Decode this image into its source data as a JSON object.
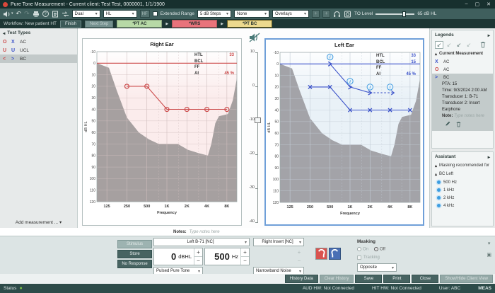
{
  "window": {
    "title": "Pure Tone Measurement - Current client: Test Test, 0000001, 1/1/1900"
  },
  "icons": {
    "caret_down": "▾",
    "arrow_right_small": "▸",
    "collapse_up": "▴",
    "sidebar_collapse": "◂",
    "undo": "↶",
    "redo": "↷",
    "legend_icon": "↙",
    "minimize": "–",
    "maximize": "▢",
    "close": "✕",
    "help": "?",
    "plus": "+",
    "minus": "−",
    "status_dot": "●",
    "workflow_arrow": "▶",
    "info": "i",
    "popout": "▣"
  },
  "colors": {
    "right_ear_accent": "#cc4b4b",
    "left_ear_accent": "#3b52c9",
    "masking_badge": "#3f9be0",
    "workflow_green": "#b7d9a6",
    "workflow_red": "#e8737b",
    "workflow_yellow": "#ecd98e",
    "status_ok": "#7ac143"
  },
  "toolbar": {
    "dual_select": "Dual",
    "hl_select": "HL",
    "hf_button": "HF",
    "extended_range_label": "Extended Range",
    "step_select": "5 dB Steps",
    "stimulus_select": "None",
    "overlays_select": "Overlays",
    "to_level_label": "TO Level",
    "to_level_value": "65 dB HL"
  },
  "workflow": {
    "label": "Workflow: New patient HT",
    "finish_button": "Finish",
    "next_step_button": "Next Step",
    "steps": [
      {
        "label": "*PT AC",
        "state": "done"
      },
      {
        "label": "*WRS",
        "state": "done"
      },
      {
        "label": "*PT BC",
        "state": "current"
      }
    ]
  },
  "test_types": {
    "header": "Test Types",
    "items": [
      {
        "left_symbol": "O",
        "right_symbol": "X",
        "label": "AC",
        "selected": false
      },
      {
        "left_symbol": "U",
        "right_symbol": "U",
        "label": "UCL",
        "selected": false
      },
      {
        "left_symbol": "<",
        "right_symbol": ">",
        "label": "BC",
        "selected": true
      }
    ],
    "add_measurement": "Add measurement ..."
  },
  "level_slider": {
    "tick_labels": [
      "10",
      "0",
      "-10",
      "-20",
      "-30",
      "-40"
    ],
    "handle_at": "-10"
  },
  "chart_data": [
    {
      "id": "r",
      "name": "right-ear-audiogram",
      "type": "line",
      "title": "Right Ear",
      "xlabel": "Frequency",
      "ylabel": "dB HL",
      "x_ticks": [
        "125",
        "250",
        "500",
        "1K",
        "2K",
        "4K",
        "8K"
      ],
      "tick_freqs": [
        125,
        250,
        500,
        1000,
        2000,
        4000,
        8000
      ],
      "minor_gridlines": [
        750,
        1500,
        3000,
        6000
      ],
      "ylim": [
        -10,
        120
      ],
      "accent": "#cc4b4b",
      "bg_tint": "#fbecec",
      "shade_color": "#a6a0a0",
      "grid_color": "#cfbdbd",
      "zero_line_db": 0,
      "selected": false,
      "series": [
        {
          "name": "AC Right",
          "marker": "circle",
          "style": "solid",
          "color": "#cc4b4b",
          "x": [
            250,
            500,
            1000,
            2000,
            4000,
            8000
          ],
          "y": [
            20,
            20,
            40,
            40,
            40,
            40
          ]
        }
      ],
      "masking_badges": [],
      "legend": [
        {
          "label": "HTL",
          "value": "33"
        },
        {
          "label": "BCL",
          "value": ""
        },
        {
          "label": "FF",
          "value": ""
        },
        {
          "label": "AI",
          "value": "45 %"
        }
      ],
      "shaded_region": [
        [
          0,
          0
        ],
        [
          0.6,
          4
        ],
        [
          1.0,
          24
        ],
        [
          1.5,
          47
        ],
        [
          2.1,
          60
        ],
        [
          2.6,
          66
        ],
        [
          3.1,
          70
        ],
        [
          4.05,
          70
        ],
        [
          4.55,
          75
        ],
        [
          5.1,
          78
        ],
        [
          5.55,
          80
        ],
        [
          5.72,
          70
        ],
        [
          5.92,
          52
        ],
        [
          6.1,
          46
        ],
        [
          6.55,
          44
        ],
        [
          6.8,
          32
        ],
        [
          7,
          13
        ]
      ]
    },
    {
      "id": "l",
      "name": "left-ear-audiogram",
      "type": "line",
      "title": "Left Ear",
      "xlabel": "Frequency",
      "ylabel": "dB HL",
      "x_ticks": [
        "125",
        "250",
        "500",
        "1K",
        "2K",
        "4K",
        "8K"
      ],
      "tick_freqs": [
        125,
        250,
        500,
        1000,
        2000,
        4000,
        8000
      ],
      "minor_gridlines": [
        750,
        1500,
        3000,
        6000
      ],
      "ylim": [
        -10,
        120
      ],
      "accent": "#3b52c9",
      "bg_tint": "#e9f1f7",
      "shade_color": "#a3a3a8",
      "grid_color": "#c2ccd6",
      "zero_line_db": 0,
      "selected": true,
      "series": [
        {
          "name": "AC Left",
          "marker": "x",
          "style": "solid",
          "color": "#3b52c9",
          "x": [
            250,
            500,
            1000,
            2000,
            4000,
            8000
          ],
          "y": [
            20,
            20,
            40,
            40,
            40,
            40
          ]
        },
        {
          "name": "BC Left",
          "marker": "gt",
          "style": "solid",
          "color": "#3b52c9",
          "x": [
            500,
            1000,
            2000
          ],
          "y": [
            0,
            20,
            25
          ]
        },
        {
          "name": "BC Left extension",
          "marker": "none",
          "style": "dashed",
          "arrow": true,
          "color": "#3b52c9",
          "x": [
            2000,
            4600
          ],
          "y": [
            25,
            25
          ]
        }
      ],
      "masking_badges": [
        [
          500,
          -6
        ],
        [
          1000,
          15
        ],
        [
          2000,
          20
        ],
        [
          4000,
          20
        ]
      ],
      "legend": [
        {
          "label": "HTL",
          "value": "33"
        },
        {
          "label": "BCL",
          "value": "15"
        },
        {
          "label": "FF",
          "value": ""
        },
        {
          "label": "AI",
          "value": "45 %"
        }
      ],
      "shaded_region": [
        [
          0,
          0
        ],
        [
          0.6,
          4
        ],
        [
          1.0,
          24
        ],
        [
          1.5,
          47
        ],
        [
          2.1,
          60
        ],
        [
          2.6,
          66
        ],
        [
          3.1,
          70
        ],
        [
          4.05,
          70
        ],
        [
          4.55,
          75
        ],
        [
          5.1,
          78
        ],
        [
          5.55,
          80
        ],
        [
          5.72,
          70
        ],
        [
          5.92,
          52
        ],
        [
          6.1,
          46
        ],
        [
          6.55,
          44
        ],
        [
          6.8,
          32
        ],
        [
          7,
          13
        ]
      ]
    }
  ],
  "legends_panel": {
    "header": "Legends",
    "current_measurement": {
      "header": "Current Measurement",
      "items": [
        {
          "symbol": "X",
          "label": "AC",
          "selected": false
        },
        {
          "symbol": "O",
          "label": "AC",
          "selected": false
        },
        {
          "symbol": ">",
          "label": "BC",
          "selected": true
        }
      ],
      "details": [
        "PTA: 15",
        "Time: 9/3/2024 2:00 AM",
        "Transducer 1: B-71",
        "Transducer 2: Insert Earphone"
      ],
      "note_label": "Note:",
      "note_placeholder": "Type notes here"
    }
  },
  "assistant": {
    "header": "Assistant",
    "group1": "Masking recommended for",
    "group2": "BC  Left",
    "items": [
      "500 Hz",
      "1 kHz",
      "2 kHz",
      "4 kHz"
    ]
  },
  "notes": {
    "label": "Notes:",
    "placeholder": "Type notes here"
  },
  "controls": {
    "stimulus_button": "Stimulus",
    "store_button": "Store",
    "no_response_button": "No Response",
    "transducer_select": "Left B-71 [NC]",
    "level_value": "0",
    "level_unit": "dBHL",
    "freq_value": "500",
    "freq_unit": "Hz",
    "stimulus_type_select": "Pulsed Pure Tone",
    "masking_transducer_select": "Right Insert [NC]",
    "masking_noise_select": "Narrowband Noise",
    "masking": {
      "label": "Masking",
      "on_label": "On",
      "off_label": "Off",
      "selected": "Off",
      "tracking_label": "Tracking",
      "routing_select": "Opposite"
    }
  },
  "actions": {
    "buttons": [
      {
        "label": "History Data",
        "enabled": true
      },
      {
        "label": "Clear History",
        "enabled": false
      },
      {
        "label": "Save",
        "enabled": true
      },
      {
        "label": "Print",
        "enabled": true
      },
      {
        "label": "Close",
        "enabled": true
      },
      {
        "label": "Show/Hide Client View",
        "enabled": false
      }
    ]
  },
  "statusbar": {
    "status_label": "Status",
    "aud_hw": "AUD HW: Not Connected",
    "hit_hw": "HIT HW: Not Connected",
    "user": "User: ABC",
    "mode": "MEAS"
  }
}
